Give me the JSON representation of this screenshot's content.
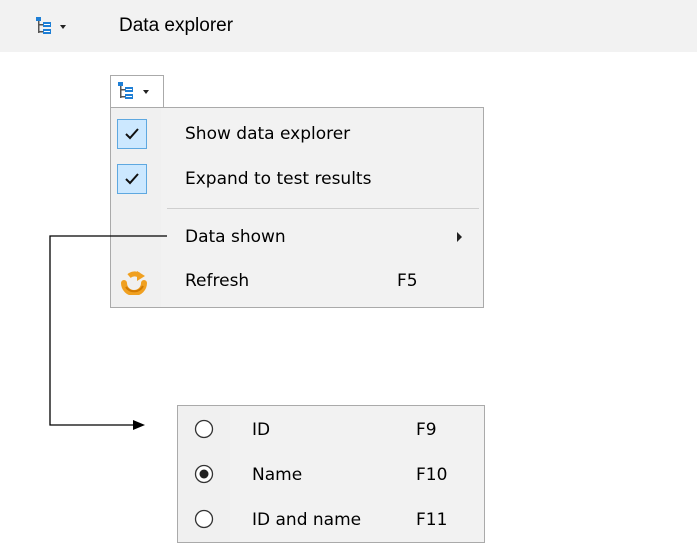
{
  "header": {
    "title": "Data explorer",
    "icon": "tree-view-icon"
  },
  "dropdown_button": {
    "icon": "tree-view-icon"
  },
  "menu": {
    "items": [
      {
        "label": "Show data explorer",
        "checked": true
      },
      {
        "label": "Expand to test results",
        "checked": true
      },
      {
        "label": "Data shown",
        "has_submenu": true
      },
      {
        "label": "Refresh",
        "shortcut": "F5",
        "icon": "refresh-icon"
      }
    ]
  },
  "submenu": {
    "items": [
      {
        "label": "ID",
        "shortcut": "F9",
        "selected": false
      },
      {
        "label": "Name",
        "shortcut": "F10",
        "selected": true
      },
      {
        "label": "ID and name",
        "shortcut": "F11",
        "selected": false
      }
    ]
  },
  "colors": {
    "check_bg": "#cce8ff",
    "check_border": "#5ea8e0",
    "tree_icon_blue": "#1e7fd6",
    "refresh_orange": "#f0a020"
  }
}
